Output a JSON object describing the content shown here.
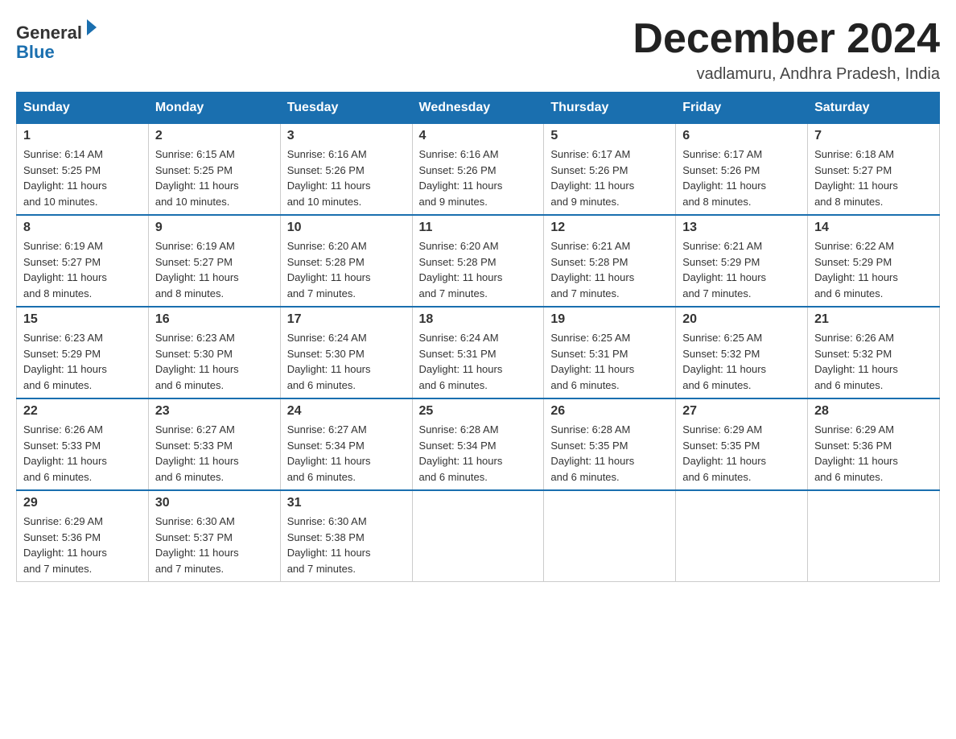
{
  "header": {
    "logo_general": "General",
    "logo_blue": "Blue",
    "month_year": "December 2024",
    "location": "vadlamuru, Andhra Pradesh, India"
  },
  "days_of_week": [
    "Sunday",
    "Monday",
    "Tuesday",
    "Wednesday",
    "Thursday",
    "Friday",
    "Saturday"
  ],
  "weeks": [
    [
      {
        "day": "1",
        "sunrise": "6:14 AM",
        "sunset": "5:25 PM",
        "daylight": "11 hours and 10 minutes."
      },
      {
        "day": "2",
        "sunrise": "6:15 AM",
        "sunset": "5:25 PM",
        "daylight": "11 hours and 10 minutes."
      },
      {
        "day": "3",
        "sunrise": "6:16 AM",
        "sunset": "5:26 PM",
        "daylight": "11 hours and 10 minutes."
      },
      {
        "day": "4",
        "sunrise": "6:16 AM",
        "sunset": "5:26 PM",
        "daylight": "11 hours and 9 minutes."
      },
      {
        "day": "5",
        "sunrise": "6:17 AM",
        "sunset": "5:26 PM",
        "daylight": "11 hours and 9 minutes."
      },
      {
        "day": "6",
        "sunrise": "6:17 AM",
        "sunset": "5:26 PM",
        "daylight": "11 hours and 8 minutes."
      },
      {
        "day": "7",
        "sunrise": "6:18 AM",
        "sunset": "5:27 PM",
        "daylight": "11 hours and 8 minutes."
      }
    ],
    [
      {
        "day": "8",
        "sunrise": "6:19 AM",
        "sunset": "5:27 PM",
        "daylight": "11 hours and 8 minutes."
      },
      {
        "day": "9",
        "sunrise": "6:19 AM",
        "sunset": "5:27 PM",
        "daylight": "11 hours and 8 minutes."
      },
      {
        "day": "10",
        "sunrise": "6:20 AM",
        "sunset": "5:28 PM",
        "daylight": "11 hours and 7 minutes."
      },
      {
        "day": "11",
        "sunrise": "6:20 AM",
        "sunset": "5:28 PM",
        "daylight": "11 hours and 7 minutes."
      },
      {
        "day": "12",
        "sunrise": "6:21 AM",
        "sunset": "5:28 PM",
        "daylight": "11 hours and 7 minutes."
      },
      {
        "day": "13",
        "sunrise": "6:21 AM",
        "sunset": "5:29 PM",
        "daylight": "11 hours and 7 minutes."
      },
      {
        "day": "14",
        "sunrise": "6:22 AM",
        "sunset": "5:29 PM",
        "daylight": "11 hours and 6 minutes."
      }
    ],
    [
      {
        "day": "15",
        "sunrise": "6:23 AM",
        "sunset": "5:29 PM",
        "daylight": "11 hours and 6 minutes."
      },
      {
        "day": "16",
        "sunrise": "6:23 AM",
        "sunset": "5:30 PM",
        "daylight": "11 hours and 6 minutes."
      },
      {
        "day": "17",
        "sunrise": "6:24 AM",
        "sunset": "5:30 PM",
        "daylight": "11 hours and 6 minutes."
      },
      {
        "day": "18",
        "sunrise": "6:24 AM",
        "sunset": "5:31 PM",
        "daylight": "11 hours and 6 minutes."
      },
      {
        "day": "19",
        "sunrise": "6:25 AM",
        "sunset": "5:31 PM",
        "daylight": "11 hours and 6 minutes."
      },
      {
        "day": "20",
        "sunrise": "6:25 AM",
        "sunset": "5:32 PM",
        "daylight": "11 hours and 6 minutes."
      },
      {
        "day": "21",
        "sunrise": "6:26 AM",
        "sunset": "5:32 PM",
        "daylight": "11 hours and 6 minutes."
      }
    ],
    [
      {
        "day": "22",
        "sunrise": "6:26 AM",
        "sunset": "5:33 PM",
        "daylight": "11 hours and 6 minutes."
      },
      {
        "day": "23",
        "sunrise": "6:27 AM",
        "sunset": "5:33 PM",
        "daylight": "11 hours and 6 minutes."
      },
      {
        "day": "24",
        "sunrise": "6:27 AM",
        "sunset": "5:34 PM",
        "daylight": "11 hours and 6 minutes."
      },
      {
        "day": "25",
        "sunrise": "6:28 AM",
        "sunset": "5:34 PM",
        "daylight": "11 hours and 6 minutes."
      },
      {
        "day": "26",
        "sunrise": "6:28 AM",
        "sunset": "5:35 PM",
        "daylight": "11 hours and 6 minutes."
      },
      {
        "day": "27",
        "sunrise": "6:29 AM",
        "sunset": "5:35 PM",
        "daylight": "11 hours and 6 minutes."
      },
      {
        "day": "28",
        "sunrise": "6:29 AM",
        "sunset": "5:36 PM",
        "daylight": "11 hours and 6 minutes."
      }
    ],
    [
      {
        "day": "29",
        "sunrise": "6:29 AM",
        "sunset": "5:36 PM",
        "daylight": "11 hours and 7 minutes."
      },
      {
        "day": "30",
        "sunrise": "6:30 AM",
        "sunset": "5:37 PM",
        "daylight": "11 hours and 7 minutes."
      },
      {
        "day": "31",
        "sunrise": "6:30 AM",
        "sunset": "5:38 PM",
        "daylight": "11 hours and 7 minutes."
      },
      null,
      null,
      null,
      null
    ]
  ],
  "labels": {
    "sunrise": "Sunrise:",
    "sunset": "Sunset:",
    "daylight": "Daylight:"
  }
}
